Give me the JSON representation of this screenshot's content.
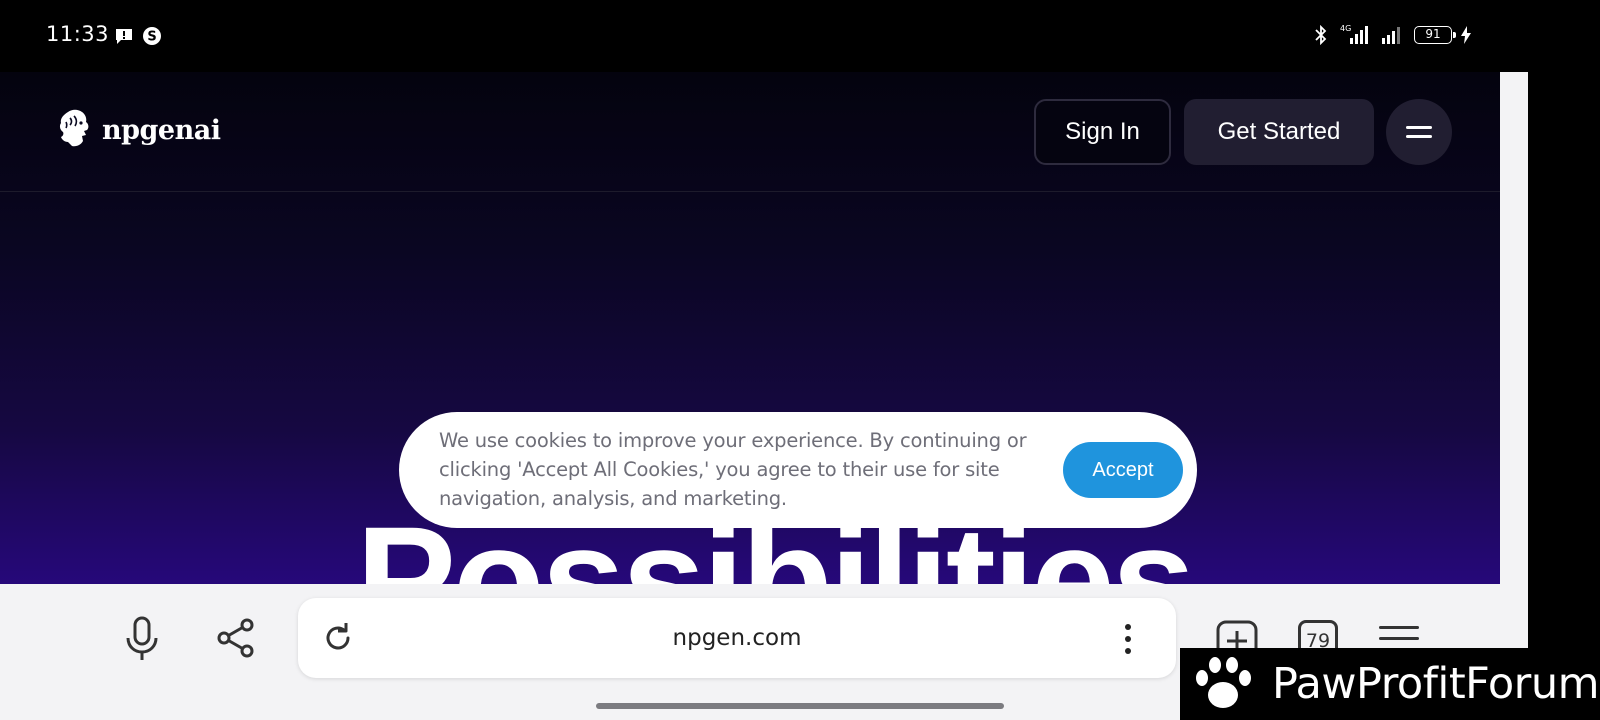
{
  "status_bar": {
    "time": "11:33",
    "notification_icons": [
      "message-alert-icon",
      "s-app-icon"
    ],
    "network": "4G",
    "battery": "91"
  },
  "site": {
    "logo_text": "npgenai",
    "sign_in_label": "Sign In",
    "get_started_label": "Get Started",
    "hero_title": "Possibilities"
  },
  "cookie_banner": {
    "text": "We use cookies to improve your experience. By continuing or clicking 'Accept All Cookies,' you agree to their use for site navigation, analysis, and marketing.",
    "accept_label": "Accept"
  },
  "browser": {
    "url": "npgen.com",
    "tab_count": "79"
  },
  "watermark": {
    "text": "PawProfitForum"
  },
  "colors": {
    "accept_button": "#1f94dd",
    "page_bg_top": "#04030e",
    "page_bg_bottom": "#26087a"
  }
}
